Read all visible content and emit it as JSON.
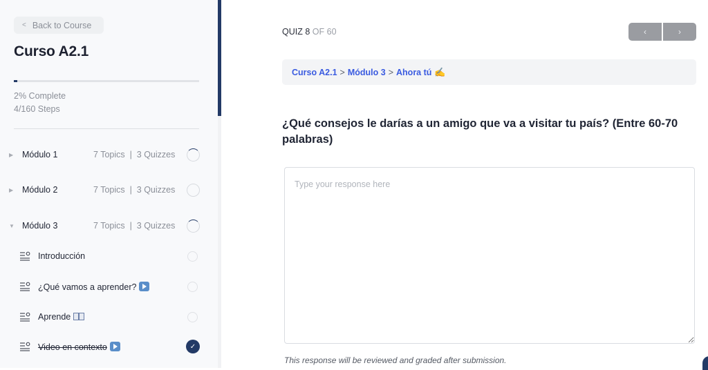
{
  "sidebar": {
    "back_label": "Back to Course",
    "course_title": "Curso A2.1",
    "progress_percent": 2,
    "percent_label": "2% Complete",
    "steps_label": "4/160 Steps",
    "modules": [
      {
        "name": "Módulo 1",
        "meta": "7 Topics  |  3 Quizzes",
        "expanded": false,
        "status": "in-progress"
      },
      {
        "name": "Módulo 2",
        "meta": "7 Topics  |  3 Quizzes",
        "expanded": false,
        "status": "not-started"
      },
      {
        "name": "Módulo 3",
        "meta": "7 Topics  |  3 Quizzes",
        "expanded": true,
        "status": "in-progress"
      }
    ],
    "lessons": [
      {
        "name": "Introducción",
        "emoji": "",
        "completed": false
      },
      {
        "name": "¿Qué vamos a aprender?",
        "emoji": "play-button",
        "completed": false
      },
      {
        "name": "Aprende",
        "emoji": "open-book",
        "completed": false
      },
      {
        "name": "Video en contexto",
        "emoji": "play-button",
        "completed": true
      }
    ]
  },
  "main": {
    "quiz_label": "QUIZ 8",
    "quiz_of": "OF 60",
    "prev_icon": "‹",
    "next_icon": "›",
    "breadcrumb": {
      "course": "Curso A2.1",
      "module": "Módulo 3",
      "current": "Ahora tú",
      "separator": ">",
      "emoji": "writing-hand"
    },
    "question": "¿Qué consejos le darías a un amigo que va a visitar tu país? (Entre 60-70 palabras)",
    "response_placeholder": "Type your response here",
    "response_value": "",
    "note": "This response will be reviewed and graded after submission."
  },
  "colors": {
    "accent_navy": "#233a66",
    "link_blue": "#3a5be0",
    "nav_button_gray": "#9a9ca1"
  }
}
